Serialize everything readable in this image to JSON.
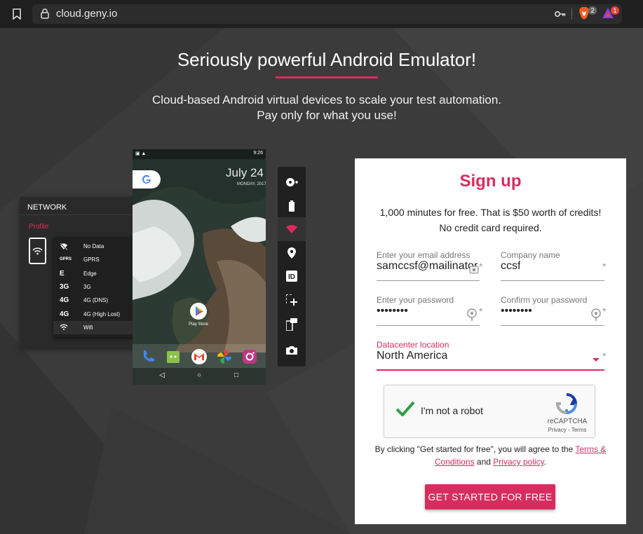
{
  "browser": {
    "url": "cloud.geny.io",
    "brave_shields_count": "2",
    "rewards_count": "1"
  },
  "hero": {
    "title": "Seriously powerful Android Emulator!",
    "subtitle_line1": "Cloud-based Android virtual devices to scale your test automation.",
    "subtitle_line2": "Pay only for what you use!"
  },
  "network_panel": {
    "title": "NETWORK",
    "profile_label": "Profile",
    "options": [
      {
        "icon": "no-data",
        "label": "No Data"
      },
      {
        "icon": "GPRS",
        "label": "GPRS"
      },
      {
        "icon": "E",
        "label": "Edge"
      },
      {
        "icon": "3G",
        "label": "3G"
      },
      {
        "icon": "4G",
        "label": "4G (DNS)"
      },
      {
        "icon": "4G",
        "label": "4G (High Lost)"
      },
      {
        "icon": "wifi",
        "label": "Wifi"
      }
    ],
    "selected": "Wifi"
  },
  "phone": {
    "status_time": "9:26",
    "date": "July 24",
    "date_sub": "MONDAY, 2017",
    "play_store_label": "Play Store"
  },
  "toolbar": {
    "tools": [
      "gps-record-icon",
      "battery-icon",
      "wifi-icon",
      "location-icon",
      "id-icon",
      "resize-icon",
      "phone-sms-icon",
      "camera-icon"
    ],
    "active_tool": "wifi-icon"
  },
  "signup": {
    "title": "Sign up",
    "promo_line1": "1,000 minutes for free. That is $50 worth of credits!",
    "promo_line2": "No credit card required.",
    "email": {
      "label": "Enter your email address",
      "value": "samccsf@mailinator"
    },
    "company": {
      "label": "Company name",
      "value": "ccsf"
    },
    "password": {
      "label": "Enter your password",
      "value": "••••••••"
    },
    "confirm_password": {
      "label": "Confirm your password",
      "value": "••••••••"
    },
    "datacenter": {
      "label": "Datacenter location",
      "value": "North America"
    },
    "required_marker": "*",
    "captcha": {
      "text": "I'm not a robot",
      "brand": "reCAPTCHA",
      "links": "Privacy - Terms"
    },
    "terms_prefix": "By clicking \"Get started for free\", you will agree to the ",
    "terms_link": "Terms & Conditions",
    "terms_and": " and ",
    "privacy_link": "Privacy policy",
    "terms_suffix": ".",
    "cta": "GET STARTED FOR FREE"
  },
  "colors": {
    "accent": "#d72d5e",
    "background": "#3a3a3a",
    "card": "#ffffff"
  }
}
